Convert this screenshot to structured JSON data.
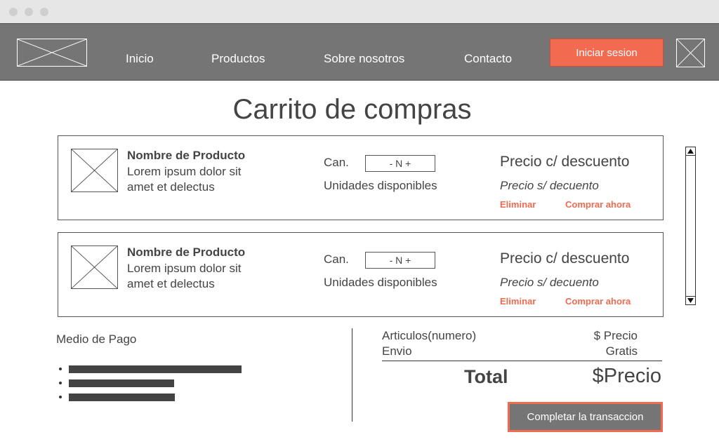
{
  "nav": {
    "links": [
      "Inicio",
      "Productos",
      "Sobre nosotros",
      "Contacto"
    ],
    "login_label": "Iniciar sesion"
  },
  "page": {
    "title": "Carrito de compras"
  },
  "cart_items": [
    {
      "name": "Nombre de Producto",
      "description": "Lorem ipsum dolor sit amet et delectus",
      "quantity_label": "Can.",
      "quantity_value": "- N +",
      "units_label": "Unidades disponibles",
      "price_discounted": "Precio c/ descuento",
      "price_original": "Precio s/ decuento",
      "remove_label": "Eliminar",
      "buy_label": "Comprar ahora"
    },
    {
      "name": "Nombre de Producto",
      "description": "Lorem ipsum dolor sit amet et delectus",
      "quantity_label": "Can.",
      "quantity_value": "- N +",
      "units_label": "Unidades disponibles",
      "price_discounted": "Precio c/ descuento",
      "price_original": "Precio s/ decuento",
      "remove_label": "Eliminar",
      "buy_label": "Comprar ahora"
    }
  ],
  "payment": {
    "label": "Medio de Pago"
  },
  "summary": {
    "articles_label": "Articulos(numero)",
    "articles_value": "$ Precio",
    "shipping_label": "Envio",
    "shipping_value": "Gratis",
    "total_label": "Total",
    "total_value": "$Precio"
  },
  "checkout": {
    "button_label": "Completar la transaccion"
  },
  "colors": {
    "accent": "#f26a4f",
    "nav_bg": "#757575"
  }
}
